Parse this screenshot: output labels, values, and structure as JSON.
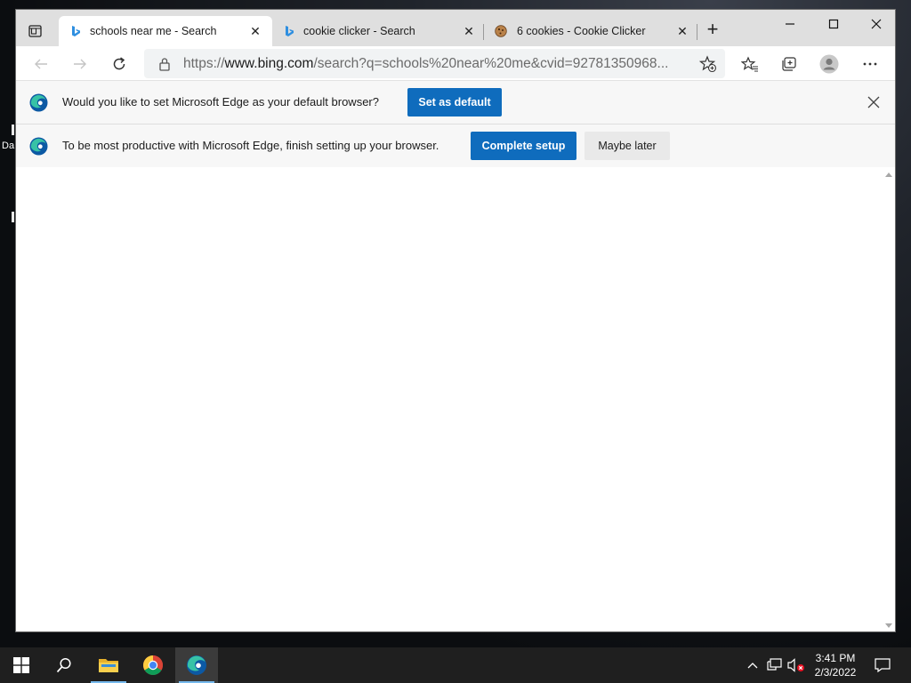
{
  "desktop": {
    "fragment_label": "Da"
  },
  "browser": {
    "tabs": [
      {
        "title": "schools near me - Search",
        "favicon": "bing-icon",
        "active": true
      },
      {
        "title": "cookie clicker - Search",
        "favicon": "bing-icon",
        "active": false
      },
      {
        "title": "6 cookies - Cookie Clicker",
        "favicon": "cookie-icon",
        "active": false
      }
    ],
    "url_prefix": "https://",
    "url_host": "www.bing.com",
    "url_path": "/search?q=schools%20near%20me&cvid=92781350968...",
    "infobars": [
      {
        "message": "Would you like to set Microsoft Edge as your default browser?",
        "primary_button": "Set as default"
      },
      {
        "message": "To be most productive with Microsoft Edge, finish setting up your browser.",
        "primary_button": "Complete setup",
        "secondary_button": "Maybe later"
      }
    ]
  },
  "taskbar": {
    "apps": [
      "windows-start-icon",
      "search-icon",
      "file-explorer-icon",
      "chrome-icon",
      "edge-icon"
    ],
    "time": "3:41 PM",
    "date": "2/3/2022"
  },
  "colors": {
    "accent": "#0f6cbd",
    "tabstrip": "#dfdfdf",
    "taskbar": "#1f1f1f"
  }
}
